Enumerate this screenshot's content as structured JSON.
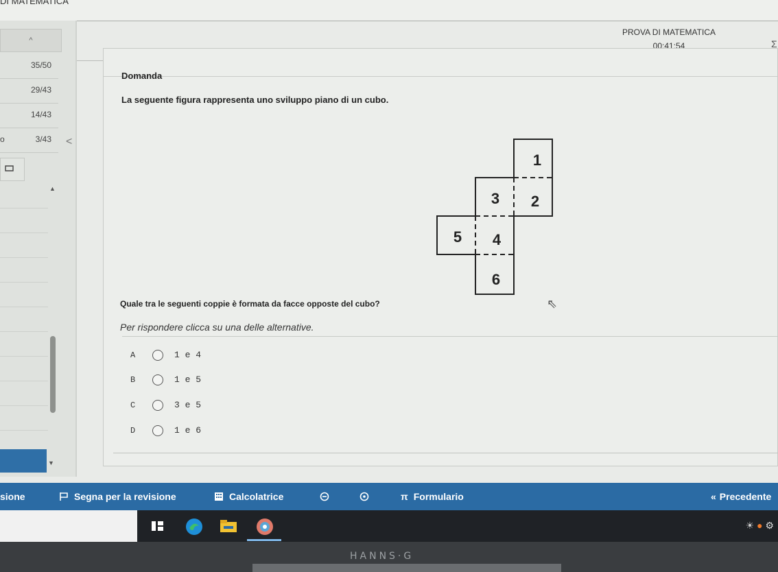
{
  "window": {
    "title_cut": "DI MATEMATICA"
  },
  "header": {
    "exam_title": "PROVA DI MATEMATICA",
    "timer": "00:41:54"
  },
  "sidebar": {
    "collapse_glyph": "^",
    "items": [
      {
        "lead": "",
        "score": "35/50"
      },
      {
        "lead": "",
        "score": "29/43"
      },
      {
        "lead": "",
        "score": "14/43"
      },
      {
        "lead": "o",
        "score": "3/43"
      }
    ],
    "toggle_glyph": "<"
  },
  "question": {
    "label": "Domanda",
    "text": "La seguente figura rappresenta uno sviluppo piano di un cubo.",
    "prompt": "Quale tra le seguenti coppie è formata da facce opposte del cubo?",
    "instruction": "Per rispondere clicca su una delle alternative.",
    "faces": {
      "f1": "1",
      "f2": "2",
      "f3": "3",
      "f4": "4",
      "f5": "5",
      "f6": "6"
    }
  },
  "options": [
    {
      "letter": "A",
      "text": "1 e 4"
    },
    {
      "letter": "B",
      "text": "1 e 5"
    },
    {
      "letter": "C",
      "text": "3 e 5"
    },
    {
      "letter": "D",
      "text": "1 e 6"
    }
  ],
  "toolbar": {
    "left_cut": "sione",
    "mark_review": "Segna per la revisione",
    "calculator": "Calcolatrice",
    "formulas_symbol": "π",
    "formulas": "Formulario",
    "previous": "Precedente"
  },
  "monitor": {
    "brand": "HANNS·G"
  },
  "colors": {
    "accent": "#2b6ba4",
    "taskbar": "#1f2226"
  }
}
